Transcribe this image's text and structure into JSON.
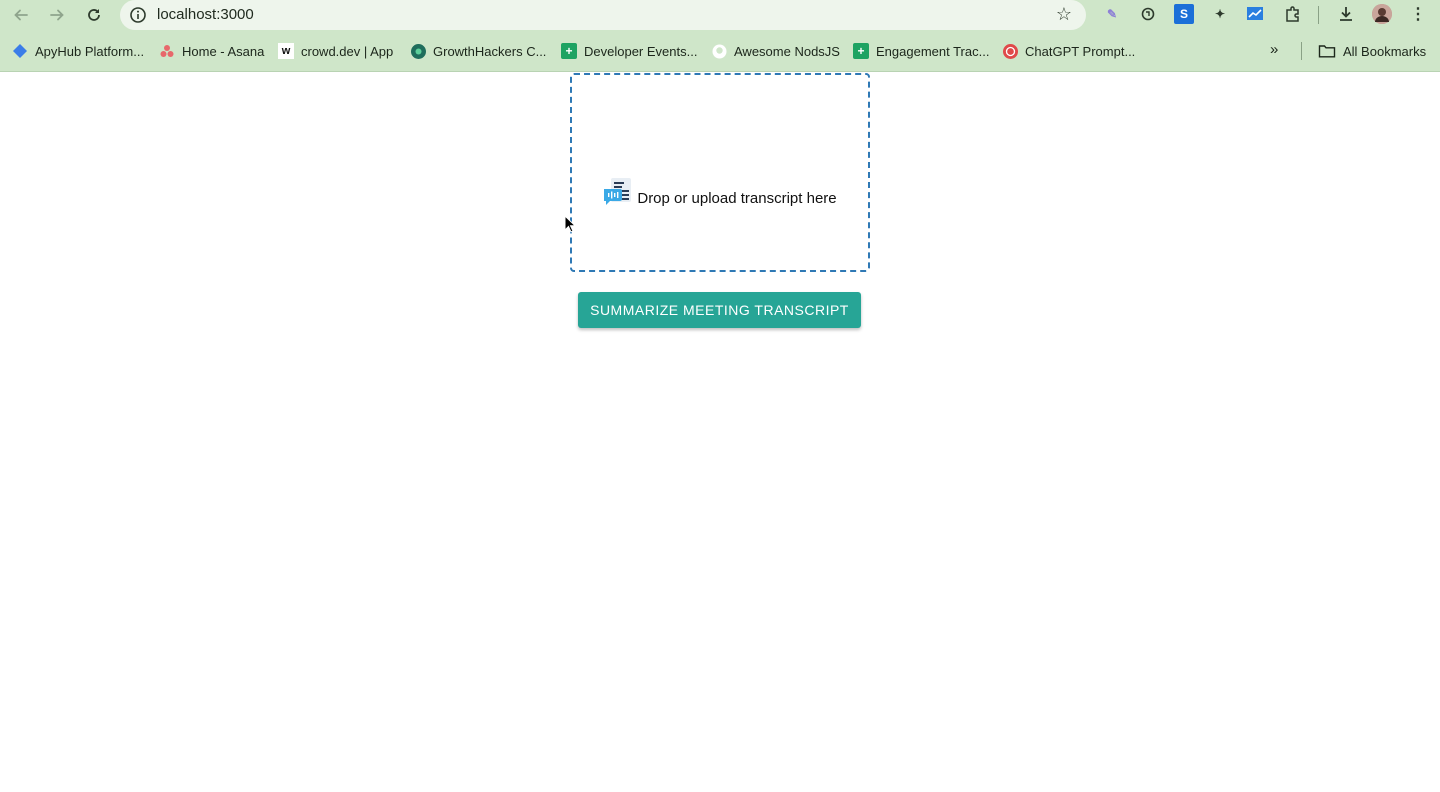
{
  "browser": {
    "url": "localhost:3000",
    "bookmarks": [
      {
        "label": "ApyHub Platform...",
        "icon": "apyhub-icon",
        "color": "#3b7de8"
      },
      {
        "label": "Home - Asana",
        "icon": "asana-icon",
        "color": "#e8686b"
      },
      {
        "label": "crowd.dev | App",
        "icon": "crowd-icon",
        "color": "#1a1a1a"
      },
      {
        "label": "GrowthHackers C...",
        "icon": "growthhackers-icon",
        "color": "#1f8a6d"
      },
      {
        "label": "Developer Events...",
        "icon": "sheets-icon",
        "color": "#1ea362"
      },
      {
        "label": "Awesome NodsJS",
        "icon": "github-icon",
        "color": "#ffffff"
      },
      {
        "label": "Engagement Trac...",
        "icon": "sheets-icon",
        "color": "#1ea362"
      },
      {
        "label": "ChatGPT Prompt...",
        "icon": "chatgpt-prompt-icon",
        "color": "#e04a4a"
      }
    ],
    "more_bookmarks": "»",
    "all_bookmarks": "All Bookmarks"
  },
  "main": {
    "dropzone_label": "Drop or upload transcript here",
    "summarize_button": "SUMMARIZE MEETING TRANSCRIPT"
  },
  "colors": {
    "accent": "#27a596",
    "dropzone_border": "#2f79b5",
    "chrome_bg": "#cfe6c9"
  }
}
